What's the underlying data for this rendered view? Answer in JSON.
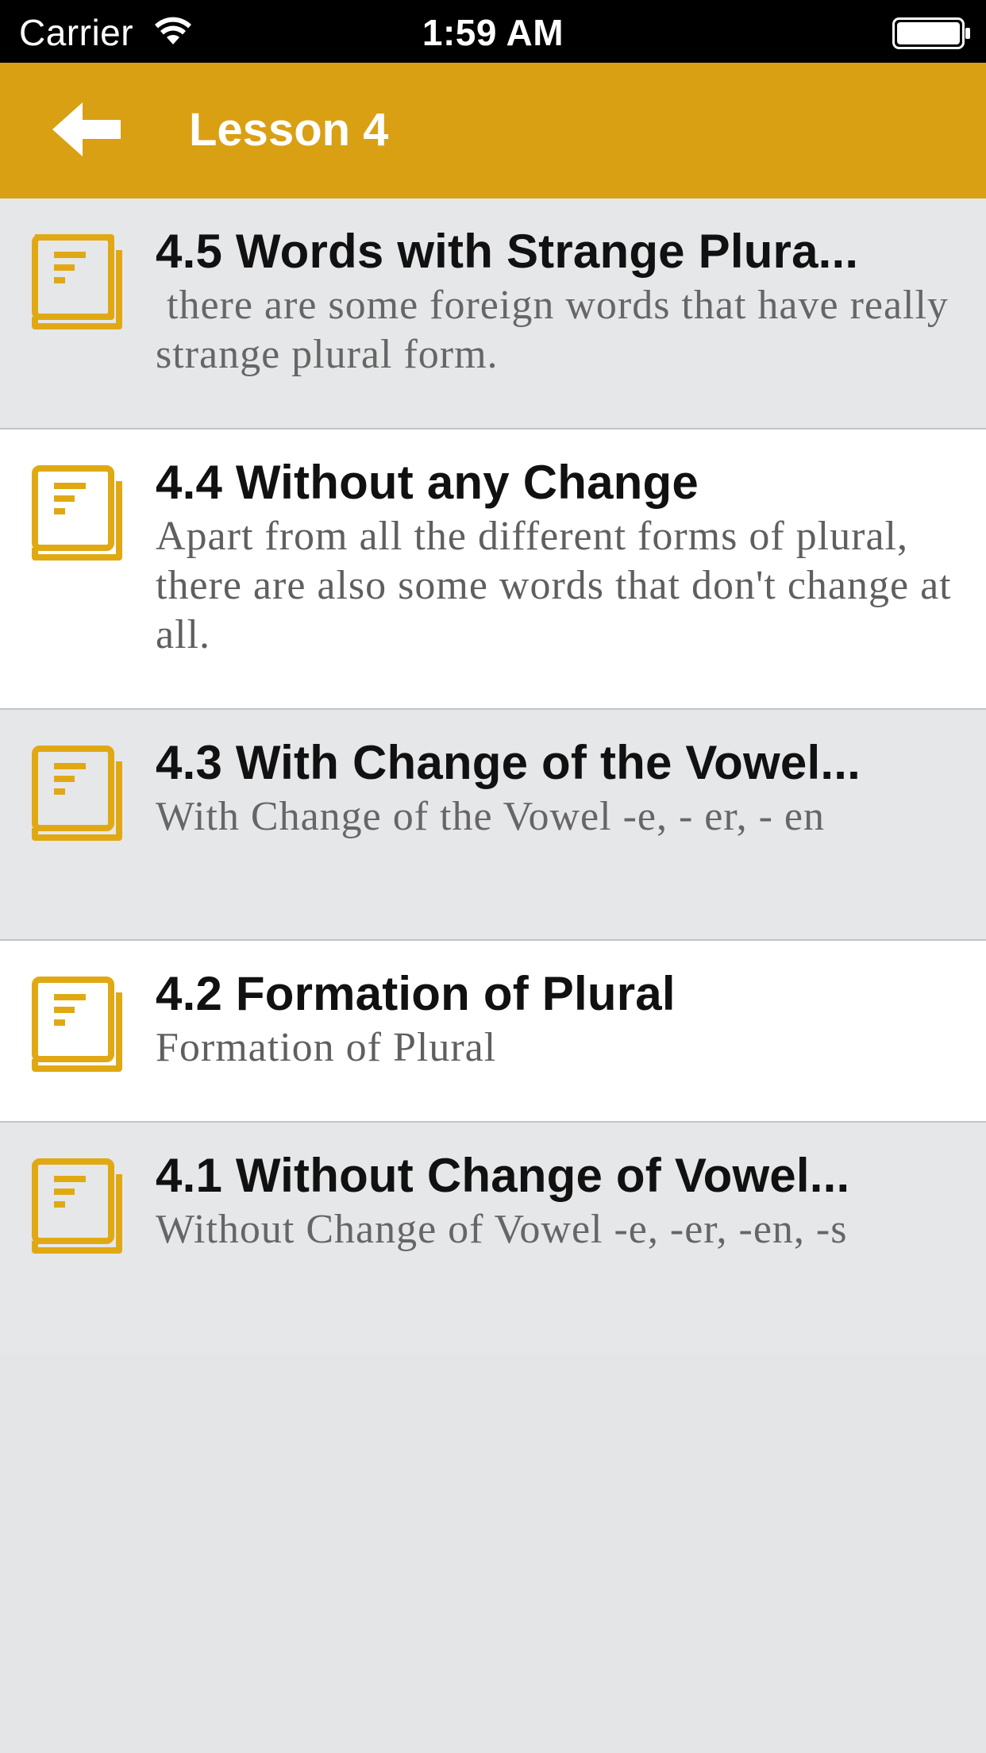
{
  "status_bar": {
    "carrier": "Carrier",
    "time": "1:59 AM",
    "icons": [
      "wifi-icon",
      "battery-icon"
    ]
  },
  "nav": {
    "back_icon": "arrow-left-icon",
    "title": "Lesson 4"
  },
  "colors": {
    "accent": "#d9a014",
    "icon": "#e0a914",
    "row_gray": "#e6e7e9",
    "row_white": "#ffffff",
    "background": "#e4e5e7"
  },
  "lessons": [
    {
      "icon": "book-icon",
      "title": "4.5 Words with Strange Plura...",
      "subtitle": " there are some foreign words that have really strange plural form."
    },
    {
      "icon": "book-icon",
      "title": "4.4 Without any Change",
      "subtitle": "Apart from all the different forms of plural, there are also some words that don't change at all."
    },
    {
      "icon": "book-icon",
      "title": "4.3 With Change of the Vowel...",
      "subtitle": "With Change of the Vowel -e, - er, - en"
    },
    {
      "icon": "book-icon",
      "title": "4.2 Formation of Plural",
      "subtitle": "Formation of Plural"
    },
    {
      "icon": "book-icon",
      "title": "4.1 Without Change of Vowel...",
      "subtitle": "Without Change of Vowel -e, -er, -en, -s"
    }
  ]
}
